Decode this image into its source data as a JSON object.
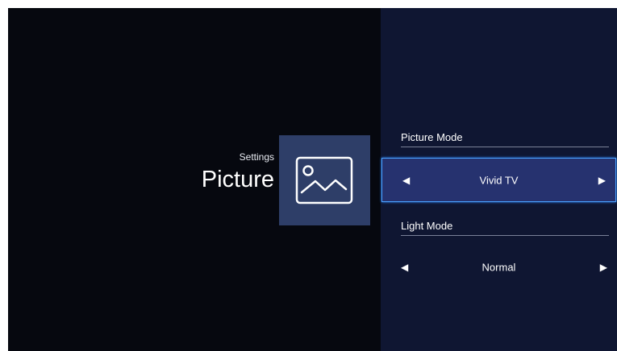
{
  "header": {
    "breadcrumb": "Settings",
    "title": "Picture",
    "icon": "picture-icon"
  },
  "settings": [
    {
      "label": "Picture Mode",
      "value": "Vivid TV",
      "focused": true,
      "left_arrow_icon": "triangle-left-icon",
      "right_arrow_icon": "triangle-right-icon"
    },
    {
      "label": "Light Mode",
      "value": "Normal",
      "focused": false,
      "left_arrow_icon": "triangle-left-icon",
      "right_arrow_icon": "triangle-right-icon"
    }
  ],
  "colors": {
    "left_background": "#06080f",
    "right_background": "#0f1632",
    "icon_tile": "#2e3e68",
    "focus_fill": "#26326f",
    "focus_border": "#4aa2ff"
  },
  "glyphs": {
    "left_arrow": "◀",
    "right_arrow": "▶"
  }
}
